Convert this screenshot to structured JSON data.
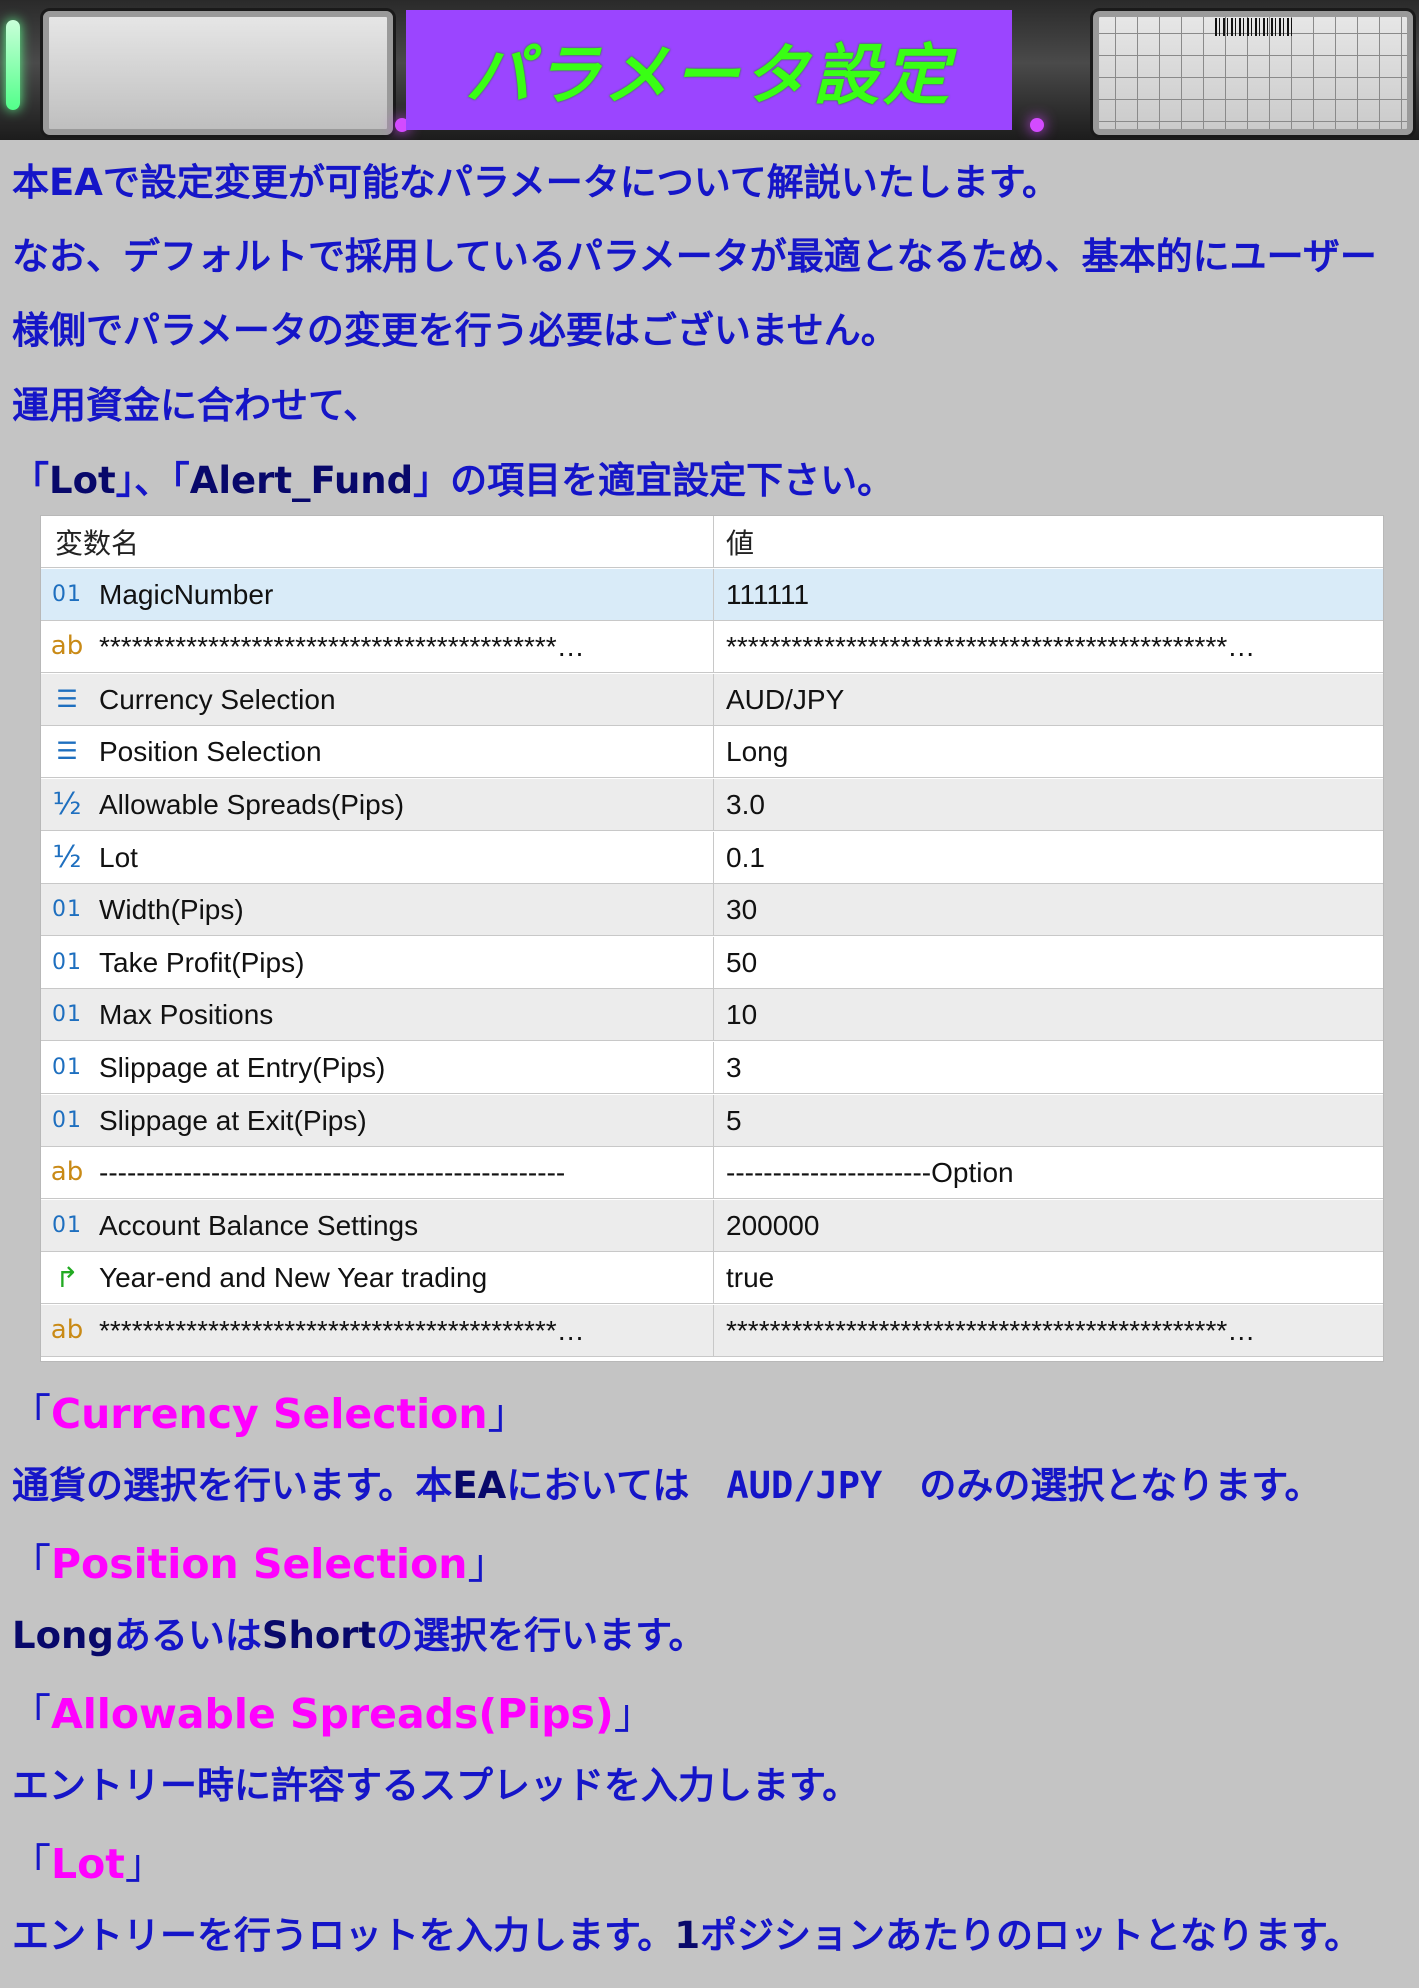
{
  "banner": {
    "title": "パラメータ設定"
  },
  "intro": {
    "line1": "本EAで設定変更が可能なパラメータについて解説いたします。",
    "line2": "なお、デフォルトで採用しているパラメータが最適となるため、基本的にユーザー",
    "line3": "様側でパラメータの変更を行う必要はございません。",
    "line4": "運用資金に合わせて、",
    "line5_open1": "「",
    "line5_lot": "Lot",
    "line5_mid": "」、「",
    "line5_alert": "Alert_Fund",
    "line5_end": "」の項目を適宜設定下さい。"
  },
  "table": {
    "header": {
      "name": "変数名",
      "value": "値"
    },
    "rows": [
      {
        "icon": "number-icon",
        "glyph": "01",
        "name": "MagicNumber",
        "value": "111111"
      },
      {
        "icon": "string-icon",
        "glyph": "ab",
        "name": "******************************************…",
        "value": "**********************************************…"
      },
      {
        "icon": "enum-icon",
        "glyph": "☰",
        "name": "Currency Selection",
        "value": "AUD/JPY"
      },
      {
        "icon": "enum-icon",
        "glyph": "☰",
        "name": "Position Selection",
        "value": "Long"
      },
      {
        "icon": "double-icon",
        "glyph": "½",
        "name": "Allowable Spreads(Pips)",
        "value": "3.0"
      },
      {
        "icon": "double-icon",
        "glyph": "½",
        "name": "Lot",
        "value": "0.1"
      },
      {
        "icon": "number-icon",
        "glyph": "01",
        "name": "Width(Pips)",
        "value": "30"
      },
      {
        "icon": "number-icon",
        "glyph": "01",
        "name": "Take Profit(Pips)",
        "value": "50"
      },
      {
        "icon": "number-icon",
        "glyph": "01",
        "name": "Max Positions",
        "value": "10"
      },
      {
        "icon": "number-icon",
        "glyph": "01",
        "name": "Slippage at Entry(Pips)",
        "value": "3"
      },
      {
        "icon": "number-icon",
        "glyph": "01",
        "name": "Slippage at Exit(Pips)",
        "value": "5"
      },
      {
        "icon": "string-icon",
        "glyph": "ab",
        "name": "--------------------------------------------------",
        "value": "----------------------Option"
      },
      {
        "icon": "number-icon",
        "glyph": "01",
        "name": "Account Balance Settings",
        "value": "200000"
      },
      {
        "icon": "bool-icon",
        "glyph": "↱",
        "name": "Year-end and New Year trading",
        "value": "true"
      },
      {
        "icon": "string-icon",
        "glyph": "ab",
        "name": "******************************************…",
        "value": "**********************************************…"
      }
    ]
  },
  "sections": {
    "open": "「",
    "close": "」",
    "currency_title": "Currency Selection",
    "currency_text_a": "通貨の選択を行います。本",
    "currency_text_ea": "EA",
    "currency_text_b": "においては　",
    "currency_text_code": "AUD/JPY",
    "currency_text_c": "　のみの選択となります。",
    "position_title": "Position Selection",
    "position_long": "Long",
    "position_text_a": "あるいは",
    "position_short": "Short",
    "position_text_b": "の選択を行います。",
    "spread_title": "Allowable Spreads(Pips)",
    "spread_text": "エントリー時に許容するスプレッドを入力します。",
    "lot_title": "Lot",
    "lot_text_a": "エントリーを行うロットを入力します。",
    "lot_text_num": "1",
    "lot_text_b": "ポジションあたりのロットとなります。"
  },
  "colors": {
    "background": "#c4c4c4",
    "body_text": "#1515c8",
    "heading": "#ff00ff",
    "title_bg": "#9b45ff",
    "title_fg": "#39ff14"
  }
}
